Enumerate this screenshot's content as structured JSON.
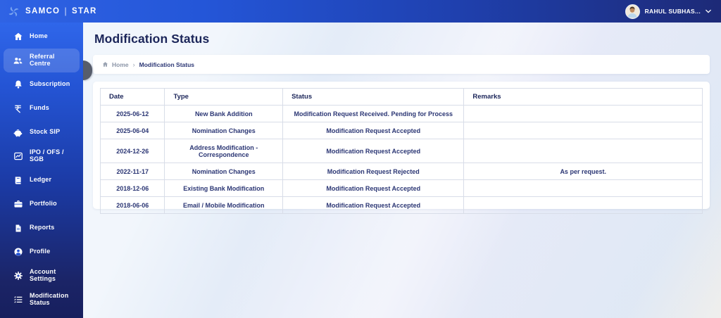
{
  "header": {
    "brand_name": "SAMCO",
    "brand_sep": "|",
    "brand_product": "STAR",
    "user_name": "RAHUL SUBHAS..."
  },
  "sidebar": {
    "items": [
      {
        "label": "Home",
        "icon": "home-icon",
        "active": false
      },
      {
        "label": "Referral Centre",
        "icon": "referral-centre-icon",
        "active": true
      },
      {
        "label": "Subscription",
        "icon": "bell-icon",
        "active": false
      },
      {
        "label": "Funds",
        "icon": "rupee-icon",
        "active": false
      },
      {
        "label": "Stock SIP",
        "icon": "piggy-bank-icon",
        "active": false
      },
      {
        "label": "IPO / OFS / SGB",
        "icon": "chart-icon",
        "active": false
      },
      {
        "label": "Ledger",
        "icon": "ledger-book-icon",
        "active": false
      },
      {
        "label": "Portfolio",
        "icon": "briefcase-icon",
        "active": false
      },
      {
        "label": "Reports",
        "icon": "document-icon",
        "active": false
      },
      {
        "label": "Profile",
        "icon": "user-circle-icon",
        "active": false
      },
      {
        "label": "Account Settings",
        "icon": "gear-icon",
        "active": false
      },
      {
        "label": "Modification Status",
        "icon": "checklist-icon",
        "active": false
      }
    ]
  },
  "page": {
    "title": "Modification Status"
  },
  "breadcrumb": {
    "home": "Home",
    "separator": "›",
    "current": "Modification Status"
  },
  "table": {
    "columns": [
      "Date",
      "Type",
      "Status",
      "Remarks"
    ],
    "rows": [
      [
        "2025-06-12",
        "New Bank Addition",
        "Modification Request Received. Pending for Process",
        ""
      ],
      [
        "2025-06-04",
        "Nomination Changes",
        "Modification Request Accepted",
        ""
      ],
      [
        "2024-12-26",
        "Address Modification - Correspondence",
        "Modification Request Accepted",
        ""
      ],
      [
        "2022-11-17",
        "Nomination Changes",
        "Modification Request Rejected",
        "As per request."
      ],
      [
        "2018-12-06",
        "Existing Bank Modification",
        "Modification Request Accepted",
        ""
      ],
      [
        "2018-06-06",
        "Email / Mobile Modification",
        "Modification Request Accepted",
        ""
      ]
    ]
  },
  "colors": {
    "header_gradient_start": "#2f63e4",
    "header_gradient_end": "#1d2a77",
    "sidebar_top": "#2f66ea",
    "sidebar_bottom": "#171f5e",
    "active_item_bg": "rgba(255,255,255,0.16)",
    "text_navy": "#2b3674",
    "page_bg": "#e3edf8",
    "logo_blue": "#7aa5f0"
  }
}
